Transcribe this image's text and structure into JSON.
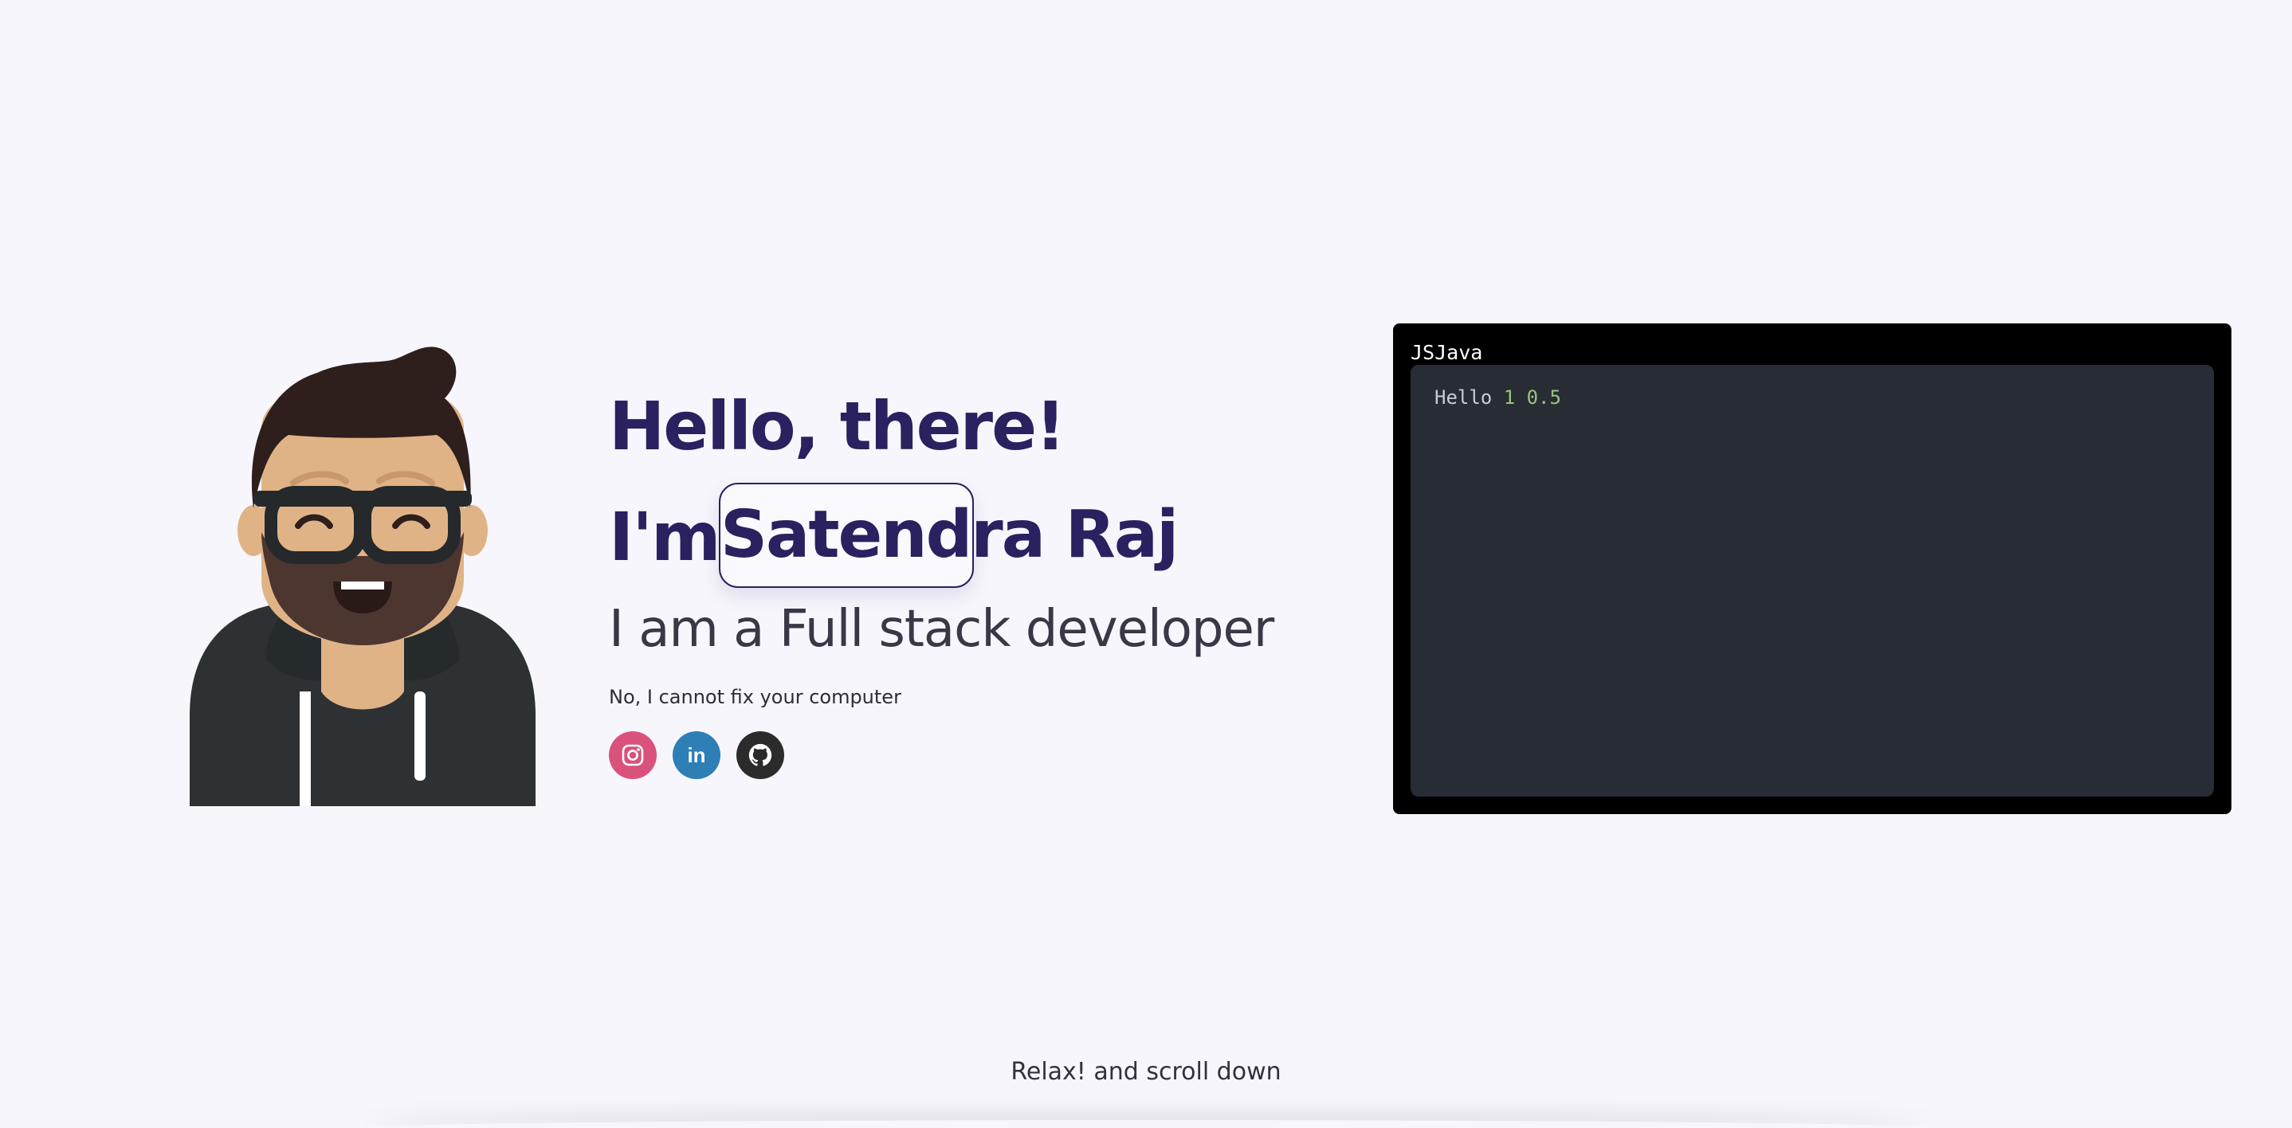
{
  "hero": {
    "greeting": "Hello, there!",
    "im_prefix": "I'm",
    "name": "Satendra Raj",
    "role": "I am a Full stack developer",
    "tagline": "No, I cannot fix your computer"
  },
  "socials": [
    {
      "name": "Instagram",
      "icon": "instagram-icon",
      "color": "#d9527b"
    },
    {
      "name": "LinkedIn",
      "icon": "linkedin-icon",
      "label": "in",
      "color": "#2d7fb6"
    },
    {
      "name": "GitHub",
      "icon": "github-icon",
      "color": "#2b2b2b"
    }
  ],
  "code_panel": {
    "tabs": "JSJava",
    "output": {
      "text": "Hello",
      "num1": "1",
      "num2": "0.5"
    }
  },
  "footer": {
    "scroll_hint": "Relax! and scroll down"
  },
  "colors": {
    "background": "#f7f6fc",
    "heading": "#2a2160",
    "editor_bg": "#282c34",
    "number_token": "#98c379"
  }
}
